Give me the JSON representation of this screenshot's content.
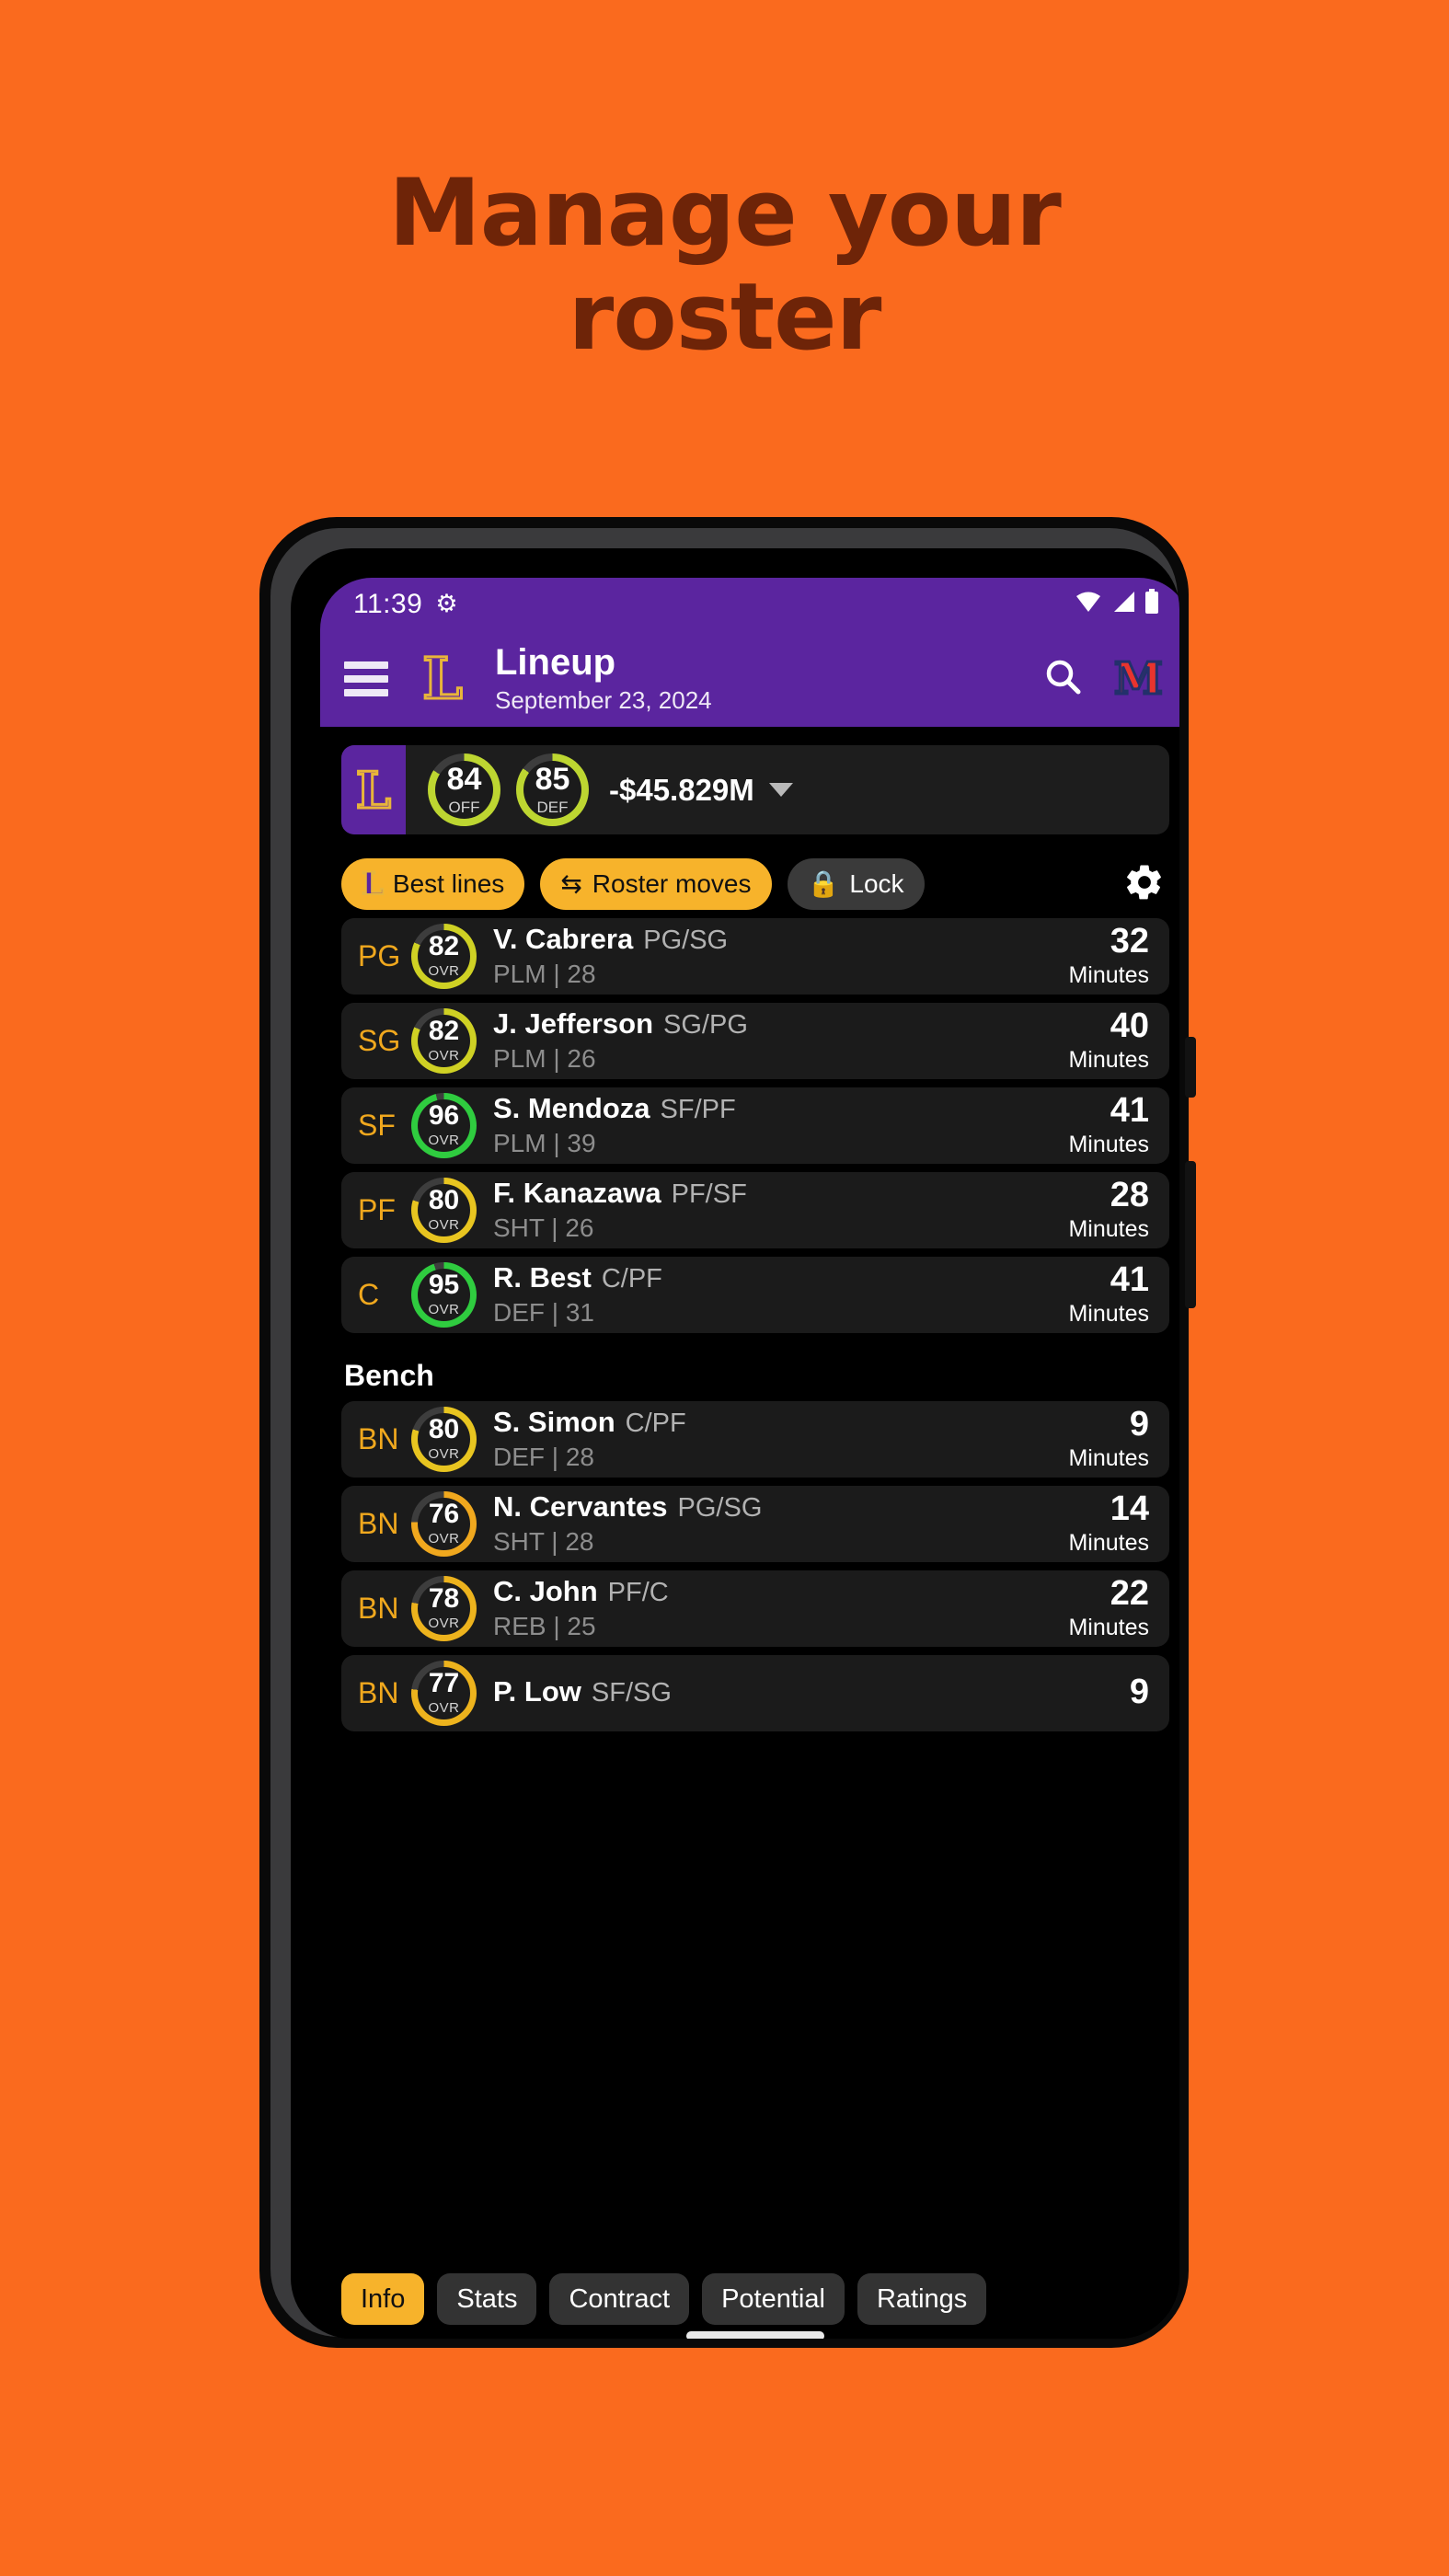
{
  "headline": "Manage your\nroster",
  "brand": {
    "orange": "#fa6a1e",
    "headline_color": "#6e2408",
    "purple": "#5b259f",
    "amber": "#f7b32b",
    "gold": "#f0a81e"
  },
  "phone": {
    "status_bar": {
      "time": "11:39",
      "debug_icon": "bug-icon",
      "wifi_icon": "wifi-icon",
      "signal_icon": "signal-icon",
      "battery_icon": "battery-icon"
    },
    "app_bar": {
      "menu_icon": "hamburger-icon",
      "team_logo": "L",
      "title": "Lineup",
      "subtitle": "September 23, 2024",
      "search_icon": "search-icon",
      "league_logo": "M"
    },
    "summary": {
      "team_logo": "L",
      "ratings": [
        {
          "label": "OFF",
          "value": "84",
          "pct": 84,
          "color": "#bdd631"
        },
        {
          "label": "DEF",
          "value": "85",
          "pct": 85,
          "color": "#bdd631"
        }
      ],
      "cap_space": "-$45.829M",
      "chevron_icon": "chevron-down-icon"
    },
    "actions": [
      {
        "label": "Best lines",
        "style": "amber",
        "icon": "team-l-icon"
      },
      {
        "label": "Roster moves",
        "style": "amber",
        "icon": "swap-icon"
      },
      {
        "label": "Lock",
        "style": "dark",
        "icon": "lock-icon"
      }
    ],
    "settings_icon": "gear-icon",
    "starters": [
      {
        "slot": "PG",
        "ovr": "82",
        "pct": 82,
        "ring": "#cfd124",
        "name": "V. Cabrera",
        "positions": "PG/SG",
        "detail": "PLM | 28",
        "minutes": "32",
        "minutes_label": "Minutes"
      },
      {
        "slot": "SG",
        "ovr": "82",
        "pct": 82,
        "ring": "#cfd124",
        "name": "J. Jefferson",
        "positions": "SG/PG",
        "detail": "PLM | 26",
        "minutes": "40",
        "minutes_label": "Minutes"
      },
      {
        "slot": "SF",
        "ovr": "96",
        "pct": 96,
        "ring": "#2fcc3f",
        "name": "S. Mendoza",
        "positions": "SF/PF",
        "detail": "PLM | 39",
        "minutes": "41",
        "minutes_label": "Minutes"
      },
      {
        "slot": "PF",
        "ovr": "80",
        "pct": 80,
        "ring": "#e8c520",
        "name": "F. Kanazawa",
        "positions": "PF/SF",
        "detail": "SHT | 26",
        "minutes": "28",
        "minutes_label": "Minutes"
      },
      {
        "slot": "C",
        "ovr": "95",
        "pct": 95,
        "ring": "#2fcc3f",
        "name": "R. Best",
        "positions": "C/PF",
        "detail": "DEF | 31",
        "minutes": "41",
        "minutes_label": "Minutes"
      }
    ],
    "bench_header": "Bench",
    "bench": [
      {
        "slot": "BN",
        "ovr": "80",
        "pct": 80,
        "ring": "#e8c520",
        "name": "S. Simon",
        "positions": "C/PF",
        "detail": "DEF | 28",
        "minutes": "9",
        "minutes_label": "Minutes"
      },
      {
        "slot": "BN",
        "ovr": "76",
        "pct": 76,
        "ring": "#f0a81e",
        "name": "N. Cervantes",
        "positions": "PG/SG",
        "detail": "SHT | 28",
        "minutes": "14",
        "minutes_label": "Minutes"
      },
      {
        "slot": "BN",
        "ovr": "78",
        "pct": 78,
        "ring": "#edb31d",
        "name": "C. John",
        "positions": "PF/C",
        "detail": "REB | 25",
        "minutes": "22",
        "minutes_label": "Minutes"
      },
      {
        "slot": "BN",
        "ovr": "77",
        "pct": 77,
        "ring": "#edb31d",
        "name": "P. Low",
        "positions": "SF/SG",
        "detail": "",
        "minutes": "9",
        "minutes_label": ""
      }
    ],
    "tabs": [
      {
        "label": "Info",
        "active": true
      },
      {
        "label": "Stats",
        "active": false
      },
      {
        "label": "Contract",
        "active": false
      },
      {
        "label": "Potential",
        "active": false
      },
      {
        "label": "Ratings",
        "active": false
      }
    ],
    "home_indicator": "home-indicator"
  }
}
